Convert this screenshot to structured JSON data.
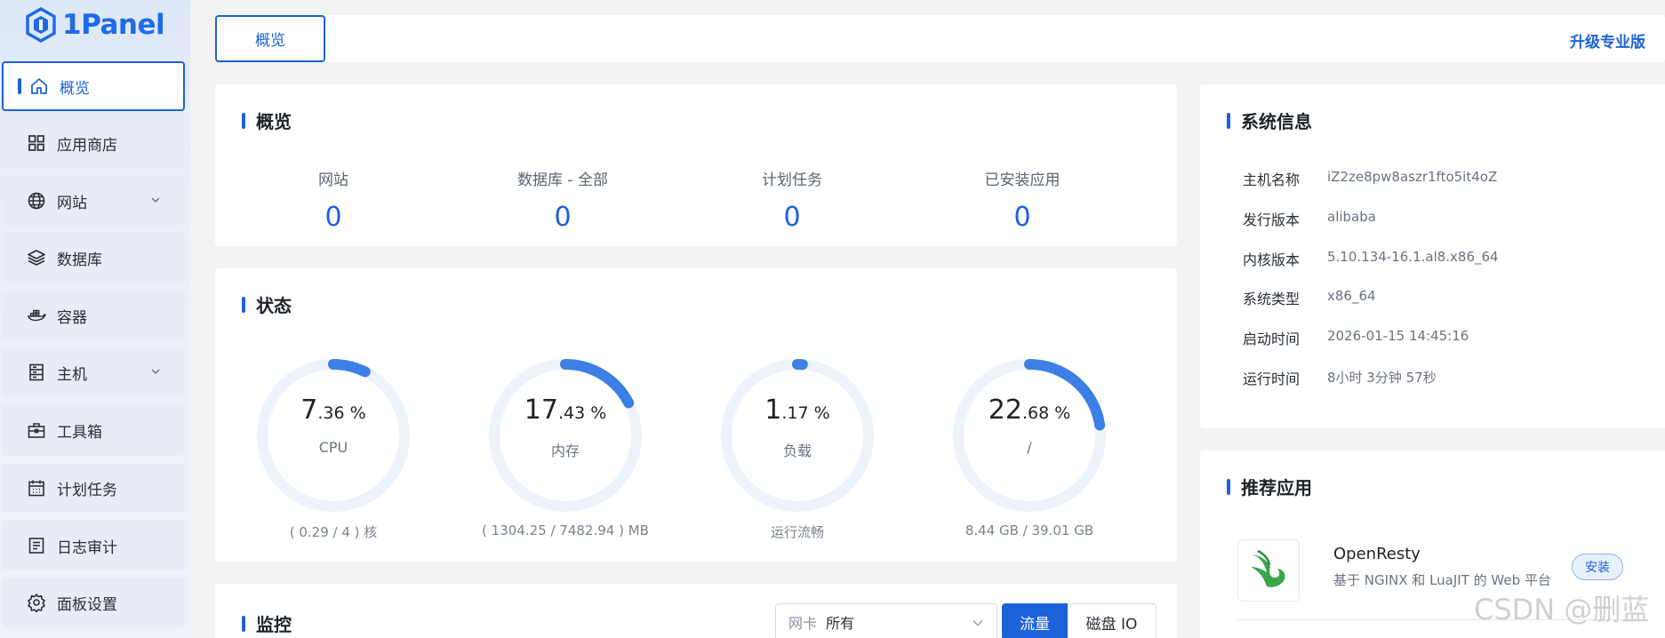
{
  "app": {
    "logo_text": "1Panel"
  },
  "sidebar": {
    "items": [
      {
        "label": "概览",
        "icon": "home-icon"
      },
      {
        "label": "应用商店",
        "icon": "apps-grid-icon"
      },
      {
        "label": "网站",
        "icon": "globe-icon"
      },
      {
        "label": "数据库",
        "icon": "layers-icon"
      },
      {
        "label": "容器",
        "icon": "docker-icon"
      },
      {
        "label": "主机",
        "icon": "server-icon"
      },
      {
        "label": "工具箱",
        "icon": "toolbox-icon"
      },
      {
        "label": "计划任务",
        "icon": "calendar-icon"
      },
      {
        "label": "日志审计",
        "icon": "log-icon"
      },
      {
        "label": "面板设置",
        "icon": "gear-icon"
      }
    ]
  },
  "header": {
    "tab": "概览",
    "upgrade": "升级专业版"
  },
  "overview": {
    "title": "概览",
    "stats": [
      {
        "label": "网站",
        "value": "0"
      },
      {
        "label": "数据库 - 全部",
        "value": "0"
      },
      {
        "label": "计划任务",
        "value": "0"
      },
      {
        "label": "已安装应用",
        "value": "0"
      }
    ]
  },
  "status": {
    "title": "状态",
    "gauges": [
      {
        "int": "7",
        "dec": ".36 %",
        "label": "CPU",
        "sub": "( 0.29 / 4 ) 核",
        "percent": 7.36
      },
      {
        "int": "17",
        "dec": ".43 %",
        "label": "内存",
        "sub": "( 1304.25 / 7482.94 ) MB",
        "percent": 17.43
      },
      {
        "int": "1",
        "dec": ".17 %",
        "label": "负载",
        "sub": "运行流畅",
        "percent": 1.17
      },
      {
        "int": "22",
        "dec": ".68 %",
        "label": "/",
        "sub": "8.44 GB / 39.01 GB",
        "percent": 22.68
      }
    ]
  },
  "monitor": {
    "title": "监控",
    "nic_label": "网卡",
    "nic_value": "所有",
    "seg_traffic": "流量",
    "seg_disk": "磁盘 IO"
  },
  "sysinfo": {
    "title": "系统信息",
    "rows": [
      {
        "key": "主机名称",
        "value": "iZ2ze8pw8aszr1fto5it4oZ"
      },
      {
        "key": "发行版本",
        "value": "alibaba"
      },
      {
        "key": "内核版本",
        "value": "5.10.134-16.1.al8.x86_64"
      },
      {
        "key": "系统类型",
        "value": "x86_64"
      },
      {
        "key": "启动时间",
        "value": "2026-01-15 14:45:16"
      },
      {
        "key": "运行时间",
        "value": "8小时 3分钟 57秒"
      }
    ]
  },
  "recommend": {
    "title": "推荐应用",
    "app_name": "OpenResty",
    "app_desc": "基于 NGINX 和 LuaJIT 的 Web 平台",
    "install": "安装"
  },
  "watermark": "CSDN @删蓝",
  "colors": {
    "accent": "#1d62d8",
    "gauge_track": "#edf2fb"
  }
}
